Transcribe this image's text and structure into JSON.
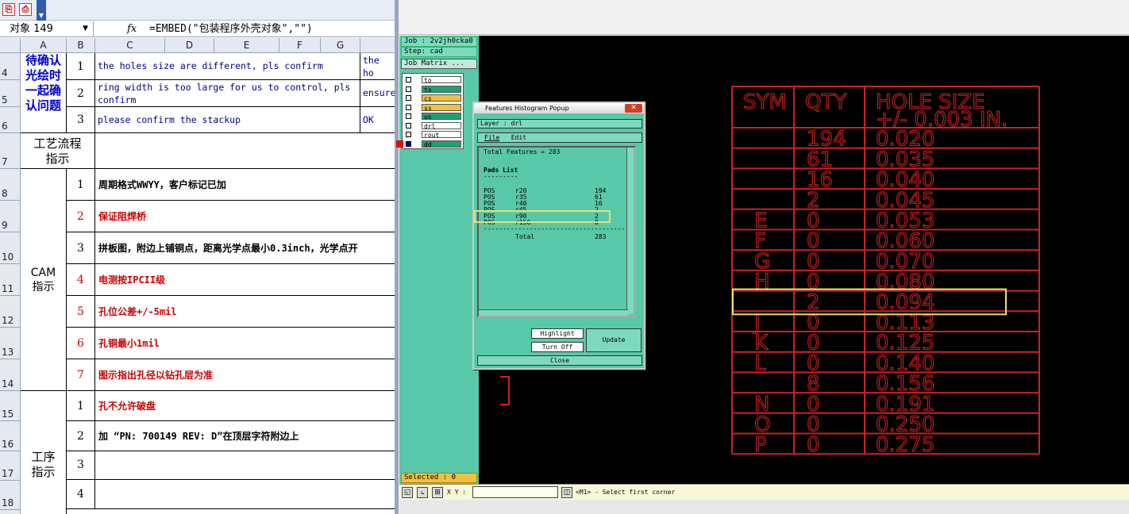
{
  "excel": {
    "toolbar_icons": [
      "pdf-icon",
      "pdf-convert-icon"
    ],
    "name_box": "对象 149",
    "fx": "fx",
    "formula": "=EMBED(\"包装程序外壳对象\",\"\")",
    "columns": [
      "A",
      "B",
      "C",
      "D",
      "E",
      "F",
      "G"
    ],
    "rows_top": [
      {
        "row": "4",
        "num": "1",
        "text": "the holes size are different, pls confirm",
        "extra": "the ho file"
      },
      {
        "row": "5",
        "num": "2",
        "text": "ring width is too large for us to control, pls confirm",
        "extra": "ensure"
      },
      {
        "row": "6",
        "num": "3",
        "text": "please confirm the stackup",
        "extra": "OK"
      }
    ],
    "section_confirm": "待确认光绘时一起确认问题",
    "row7_label": "工艺流程指示",
    "row7": "7",
    "cam_label": "CAM指示",
    "cam_rows": [
      {
        "row": "8",
        "num": "1",
        "text": "周期格式WWYY，客户标记已加",
        "color": "#000000"
      },
      {
        "row": "9",
        "num": "2",
        "text": "保证阻焊桥",
        "color": "#cc0000"
      },
      {
        "row": "10",
        "num": "3",
        "text": "拼板图，附边上铺铜点，距离光学点最小0.3inch，光学点开",
        "color": "#000000"
      },
      {
        "row": "11",
        "num": "4",
        "text": "电测按IPCII级",
        "color": "#cc0000"
      },
      {
        "row": "12",
        "num": "5",
        "text": "孔位公差+/-5mil",
        "color": "#cc0000"
      },
      {
        "row": "13",
        "num": "6",
        "text": "孔铜最小1mil",
        "color": "#cc0000"
      },
      {
        "row": "14",
        "num": "7",
        "text": "图示指出孔径以钻孔层为准",
        "color": "#cc0000"
      }
    ],
    "proc_label": "工序指示",
    "proc_rows": [
      {
        "row": "15",
        "num": "1",
        "text": "孔不允许破盘",
        "color": "#cc0000"
      },
      {
        "row": "16",
        "num": "2",
        "text": "加 “PN: 700149 REV: D”在顶层字符附边上",
        "color": "#000000"
      },
      {
        "row": "17",
        "num": "3",
        "text": "",
        "color": "#000000"
      },
      {
        "row": "18",
        "num": "4",
        "text": "",
        "color": "#000000"
      }
    ]
  },
  "cam": {
    "job": "Job : 2v2jh0cka0",
    "step": "Step: cad",
    "job_matrix": "Job Matrix ...",
    "layers": [
      {
        "name": "to",
        "color": "#ffffff"
      },
      {
        "name": "ts",
        "color": "#20a070"
      },
      {
        "name": "cs",
        "color": "#f0c040"
      },
      {
        "name": "ss",
        "color": "#f0c040"
      },
      {
        "name": "us",
        "color": "#20a070"
      },
      {
        "name": "drl",
        "color": "#ffffff"
      },
      {
        "name": "rout",
        "color": "#ffffff"
      },
      {
        "name": "dd",
        "color": "#20a070"
      }
    ],
    "selected": "Selected : 0",
    "xy_label": "X Y :",
    "status_msg": "<M1> - Select first corner",
    "table_headers": [
      "SYM",
      "QTY",
      "HOLE SIZE",
      "+/- 0.003 IN."
    ],
    "table_rows": [
      {
        "sym": "",
        "qty": "194",
        "size": "0.020"
      },
      {
        "sym": "",
        "qty": "61",
        "size": "0.035"
      },
      {
        "sym": "",
        "qty": "16",
        "size": "0.040"
      },
      {
        "sym": "",
        "qty": "2",
        "size": "0.045"
      },
      {
        "sym": "E",
        "qty": "0",
        "size": "0.053"
      },
      {
        "sym": "F",
        "qty": "0",
        "size": "0.060"
      },
      {
        "sym": "G",
        "qty": "0",
        "size": "0.070"
      },
      {
        "sym": "H",
        "qty": "0",
        "size": "0.080"
      },
      {
        "sym": "",
        "qty": "2",
        "size": "0.094"
      },
      {
        "sym": "J",
        "qty": "0",
        "size": "0.113"
      },
      {
        "sym": "K",
        "qty": "0",
        "size": "0.125"
      },
      {
        "sym": "L",
        "qty": "0",
        "size": "0.140"
      },
      {
        "sym": "",
        "qty": "8",
        "size": "0.156"
      },
      {
        "sym": "N",
        "qty": "0",
        "size": "0.191"
      },
      {
        "sym": "O",
        "qty": "0",
        "size": "0.250"
      },
      {
        "sym": "P",
        "qty": "0",
        "size": "0.275"
      }
    ]
  },
  "popup": {
    "title": "Features Histogram Popup",
    "layer": "Layer : drl",
    "menu": [
      "File",
      "Edit"
    ],
    "total": "Total Features = 283",
    "pads_list": "Pads List",
    "underline": "---------",
    "rows": [
      {
        "type": "POS",
        "sym": "r20",
        "count": "194"
      },
      {
        "type": "POS",
        "sym": "r35",
        "count": "61"
      },
      {
        "type": "POS",
        "sym": "r40",
        "count": "16"
      },
      {
        "type": "POS",
        "sym": "r45",
        "count": "2"
      },
      {
        "type": "POS",
        "sym": "r90",
        "count": "2"
      },
      {
        "type": "POS",
        "sym": "r156",
        "count": "8"
      }
    ],
    "dashes": "---------------------------------------",
    "total_label": "Total",
    "total_count": "283",
    "highlight_btn": "Highlight",
    "turnoff_btn": "Turn Off",
    "update_btn": "Update",
    "close_btn": "Close"
  }
}
